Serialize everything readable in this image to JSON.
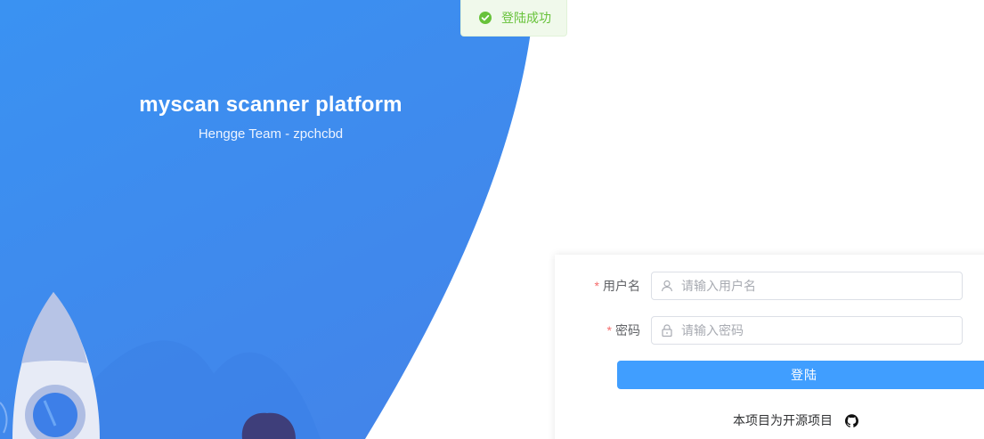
{
  "hero": {
    "title": "myscan scanner platform",
    "subtitle": "Hengge Team - zpchcbd"
  },
  "toast": {
    "type": "success",
    "icon": "check-circle-icon",
    "message": "登陆成功"
  },
  "login_form": {
    "username": {
      "label": "用户名",
      "required_mark": "*",
      "icon": "user-icon",
      "placeholder": "请输入用户名",
      "value": ""
    },
    "password": {
      "label": "密码",
      "required_mark": "*",
      "icon": "lock-icon",
      "placeholder": "请输入密码",
      "value": ""
    },
    "submit_label": "登陆",
    "footer_text": "本项目为开源项目",
    "footer_icon": "github-icon"
  },
  "colors": {
    "hero_blue": "#3f8df0",
    "primary": "#409eff",
    "success": "#67c23a",
    "required": "#f56c6c"
  }
}
